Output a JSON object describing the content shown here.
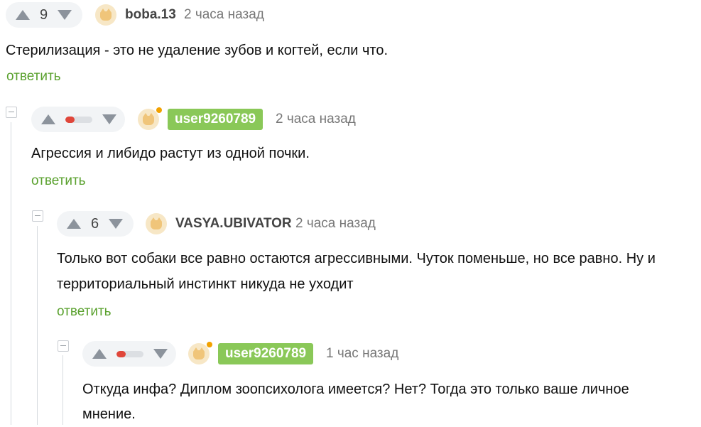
{
  "comments": [
    {
      "votes": "9",
      "username": "boba.13",
      "time": "2 часа назад",
      "text": "Стерилизация - это не удаление зубов и когтей, если что.",
      "reply": "ответить"
    },
    {
      "rating_fraction": 0.35,
      "username": "user9260789",
      "time": "2 часа назад",
      "text": "Агрессия и либидо растут из одной почки.",
      "reply": "ответить"
    },
    {
      "votes": "6",
      "username": "VASYA.UBIVATOR",
      "time": "2 часа назад",
      "text_line1": "Только вот собаки все равно остаются агрессивными. Чуток поменьше, но все равно. Ну и",
      "text_line2": "территориальный инстинкт никуда не уходит",
      "reply": "ответить"
    },
    {
      "rating_fraction": 0.35,
      "username": "user9260789",
      "time": "1 час назад",
      "text_line1": "Откуда инфа? Диплом зоопсихолога имеется? Нет? Тогда это только ваше личное",
      "text_line2": "мнение."
    }
  ],
  "colors": {
    "accent_green": "#5aa12e",
    "badge_green": "#8ac858",
    "rating_red": "#e0463a",
    "online_dot": "#f2a100"
  }
}
